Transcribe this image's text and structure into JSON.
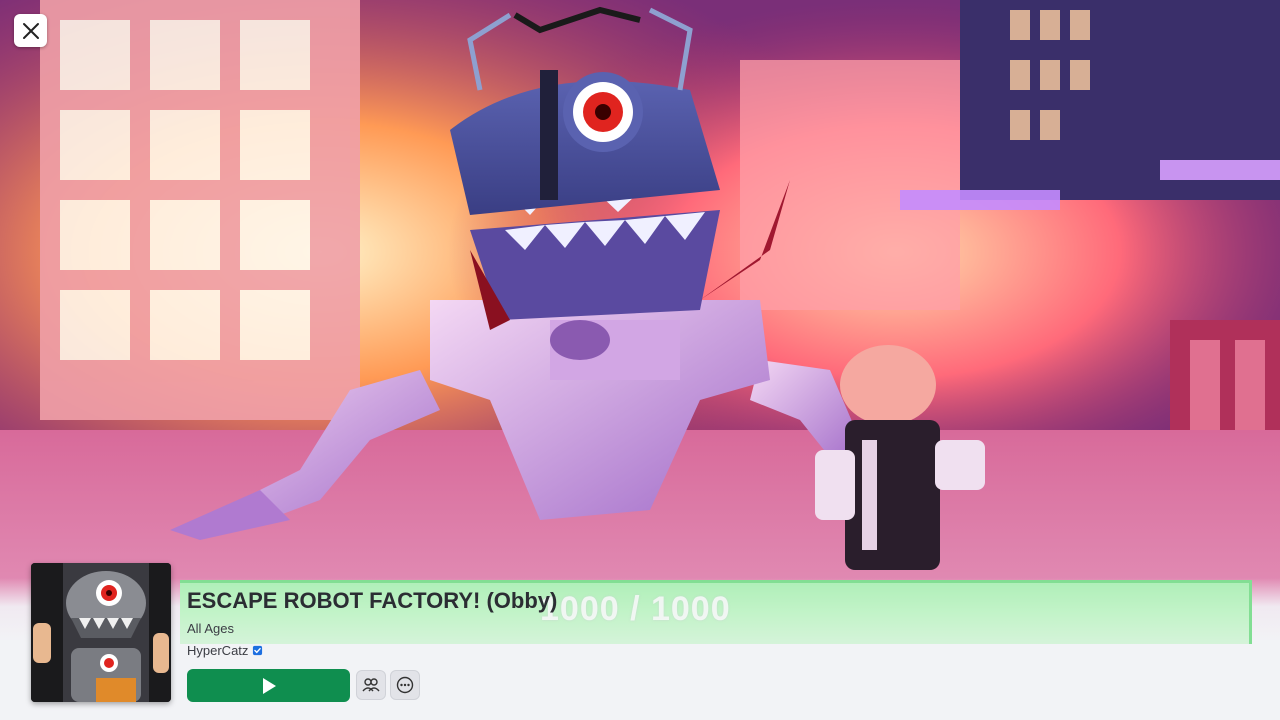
{
  "window": {
    "close_label": "Close"
  },
  "game": {
    "title": "ESCAPE ROBOT FACTORY! (Obby)",
    "age_rating": "All Ages",
    "creator": "HyperCatz",
    "creator_verified": true
  },
  "progress": {
    "label": "1000 / 1000",
    "current": 1000,
    "max": 1000
  },
  "actions": {
    "play_icon": "play-icon",
    "party_icon": "party-icon",
    "more_icon": "more-icon"
  },
  "colors": {
    "play_button": "#0f8e4f",
    "progress_bar": "#b9f2c2",
    "verified_badge": "#1e6fe0"
  }
}
